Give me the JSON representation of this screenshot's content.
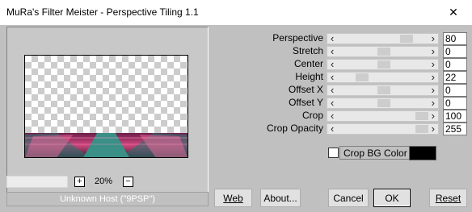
{
  "window": {
    "title": "MuRa's Filter Meister - Perspective Tiling 1.1",
    "close_glyph": "✕"
  },
  "preview": {
    "zoom_minus": "+",
    "zoom_value": "20%",
    "zoom_plus": "−"
  },
  "status_text": "Unknown Host (\"9PSP\")",
  "params": [
    {
      "label": "Perspective",
      "value": "80",
      "level": 0.8
    },
    {
      "label": "Stretch",
      "value": "0",
      "level": 0.5
    },
    {
      "label": "Center",
      "value": "0",
      "level": 0.5
    },
    {
      "label": "Height",
      "value": "22",
      "level": 0.22
    },
    {
      "label": "Offset X",
      "value": "0",
      "level": 0.5
    },
    {
      "label": "Offset Y",
      "value": "0",
      "level": 0.5
    },
    {
      "label": "Crop",
      "value": "100",
      "level": 1.0
    },
    {
      "label": "Crop Opacity",
      "value": "255",
      "level": 1.0
    }
  ],
  "crop_bg": {
    "label": "Crop BG Color",
    "checked": false,
    "color": "#000000"
  },
  "buttons": {
    "web": "Web",
    "about": "About...",
    "cancel": "Cancel",
    "ok": "OK",
    "reset": "Reset"
  },
  "colors": {
    "dialog_bg": "#c0c0c0",
    "floor_pink": "#e0508a",
    "floor_teal": "#3a8f86"
  }
}
